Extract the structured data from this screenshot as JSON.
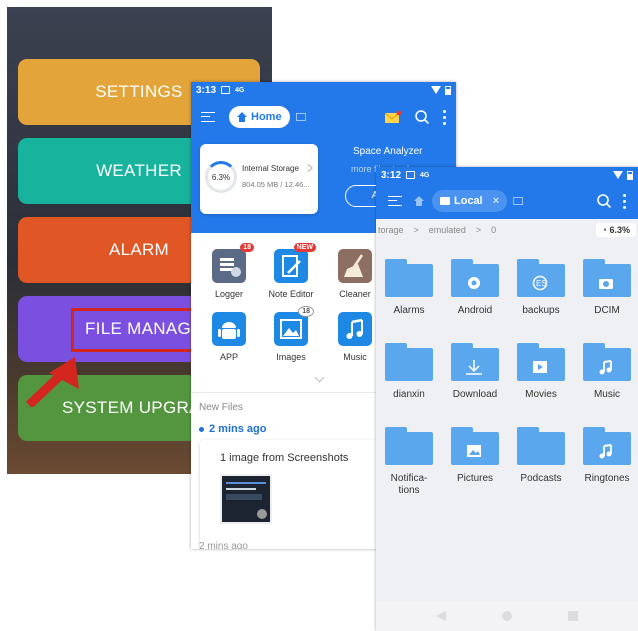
{
  "launcher": {
    "buttons": [
      {
        "label": "SETTINGS",
        "color": "#e3a43a"
      },
      {
        "label": "WEATHER",
        "color": "#18b39c"
      },
      {
        "label": "ALARM",
        "color": "#e05624"
      },
      {
        "label": "FILE MANAGER",
        "color": "#7b4fe0"
      },
      {
        "label": "SYSTEM UPGRADE",
        "color": "#54963f"
      }
    ],
    "highlight_color": "#d3261f"
  },
  "home": {
    "status": {
      "time": "3:13",
      "signal": "4G"
    },
    "tab": "Home",
    "storage": {
      "percent": "6.3%",
      "name": "Internal Storage",
      "size": "804.05 MB / 12.46..."
    },
    "analyzer": {
      "title": "Space Analyzer",
      "subtitle": "more files to clean",
      "button": "A"
    },
    "apps": [
      {
        "label": "Logger",
        "badge": "18",
        "icon": "logger-icon",
        "color": "#5b6b86"
      },
      {
        "label": "Note Editor",
        "badge": "NEW",
        "icon": "note-editor-icon",
        "color": "#1e88e5"
      },
      {
        "label": "Cleaner",
        "badge": "",
        "icon": "broom-icon",
        "color": "#8d6e63"
      },
      {
        "label": "APP",
        "badge": "",
        "icon": "android-icon",
        "color": "#1e88e5"
      },
      {
        "label": "Images",
        "badge": "18",
        "icon": "image-icon",
        "color": "#1e88e5"
      },
      {
        "label": "Music",
        "badge": "",
        "icon": "music-icon",
        "color": "#1e88e5"
      }
    ],
    "new_files_label": "New Files",
    "recent": {
      "time": "2 mins ago",
      "text": "1 image from Screenshots"
    },
    "recent_next": "2 mins ago"
  },
  "local": {
    "status": {
      "time": "3:12",
      "signal": "4G"
    },
    "tab": "Local",
    "breadcrumb": [
      "torage",
      "emulated",
      "0"
    ],
    "usage": "6.3%",
    "folders": [
      {
        "label": "Alarms",
        "icon": "folder-icon"
      },
      {
        "label": "Android",
        "icon": "settings-folder-icon"
      },
      {
        "label": "backups",
        "icon": "backup-folder-icon"
      },
      {
        "label": "DCIM",
        "icon": "camera-folder-icon"
      },
      {
        "label": "dianxin",
        "icon": "folder-icon"
      },
      {
        "label": "Download",
        "icon": "download-folder-icon"
      },
      {
        "label": "Movies",
        "icon": "movie-folder-icon"
      },
      {
        "label": "Music",
        "icon": "music-folder-icon"
      },
      {
        "label": "Notifica-tions",
        "icon": "folder-icon"
      },
      {
        "label": "Pictures",
        "icon": "picture-folder-icon"
      },
      {
        "label": "Podcasts",
        "icon": "folder-icon"
      },
      {
        "label": "Ringtones",
        "icon": "music-folder-icon"
      }
    ]
  }
}
